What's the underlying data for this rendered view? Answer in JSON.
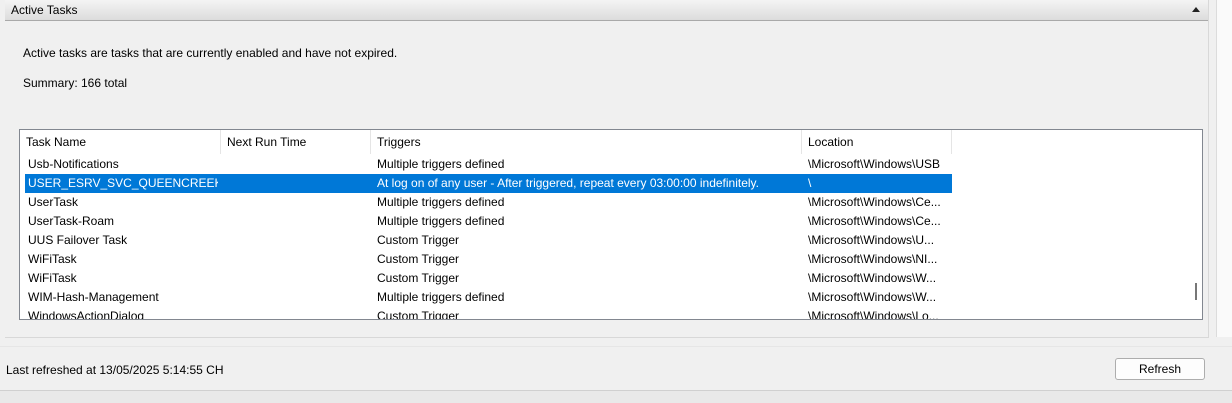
{
  "section": {
    "title": "Active Tasks",
    "description": "Active tasks are tasks that are currently enabled and have not expired.",
    "summary": "Summary: 166 total"
  },
  "table": {
    "columns": [
      "Task Name",
      "Next Run Time",
      "Triggers",
      "Location"
    ],
    "rows": [
      {
        "name": "Usb-Notifications",
        "next_run": "",
        "triggers": "Multiple triggers defined",
        "location": "\\Microsoft\\Windows\\USB",
        "selected": false
      },
      {
        "name": "USER_ESRV_SVC_QUEENCREEK",
        "next_run": "",
        "triggers": "At log on of any user - After triggered, repeat every 03:00:00 indefinitely.",
        "location": "\\",
        "selected": true
      },
      {
        "name": "UserTask",
        "next_run": "",
        "triggers": "Multiple triggers defined",
        "location": "\\Microsoft\\Windows\\Ce...",
        "selected": false
      },
      {
        "name": "UserTask-Roam",
        "next_run": "",
        "triggers": "Multiple triggers defined",
        "location": "\\Microsoft\\Windows\\Ce...",
        "selected": false
      },
      {
        "name": "UUS Failover Task",
        "next_run": "",
        "triggers": "Custom Trigger",
        "location": "\\Microsoft\\Windows\\U...",
        "selected": false
      },
      {
        "name": "WiFiTask",
        "next_run": "",
        "triggers": "Custom Trigger",
        "location": "\\Microsoft\\Windows\\NI...",
        "selected": false
      },
      {
        "name": "WiFiTask",
        "next_run": "",
        "triggers": "Custom Trigger",
        "location": "\\Microsoft\\Windows\\W...",
        "selected": false
      },
      {
        "name": "WIM-Hash-Management",
        "next_run": "",
        "triggers": "Multiple triggers defined",
        "location": "\\Microsoft\\Windows\\W...",
        "selected": false
      },
      {
        "name": "WindowsActionDialog",
        "next_run": "",
        "triggers": "Custom Trigger",
        "location": "\\Microsoft\\Windows\\Lo...",
        "selected": false
      }
    ]
  },
  "footer": {
    "last_refreshed": "Last refreshed at 13/05/2025 5:14:55 CH",
    "refresh_label": "Refresh"
  },
  "colors": {
    "selection": "#0078d7",
    "panel_bg": "#f0f0f0"
  },
  "icons": {
    "collapse": "chevron-up-icon"
  }
}
